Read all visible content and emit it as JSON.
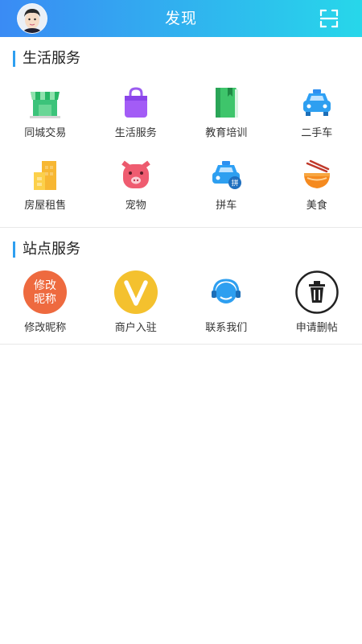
{
  "header": {
    "title": "发现"
  },
  "life": {
    "title": "生活服务",
    "items": [
      {
        "label": "同城交易",
        "icon": "market-stall-icon"
      },
      {
        "label": "生活服务",
        "icon": "shopping-bag-icon"
      },
      {
        "label": "教育培训",
        "icon": "book-icon"
      },
      {
        "label": "二手车",
        "icon": "car-icon"
      },
      {
        "label": "房屋租售",
        "icon": "building-icon"
      },
      {
        "label": "宠物",
        "icon": "pig-icon"
      },
      {
        "label": "拼车",
        "icon": "carpool-icon"
      },
      {
        "label": "美食",
        "icon": "noodle-bowl-icon"
      }
    ]
  },
  "site": {
    "title": "站点服务",
    "items": [
      {
        "label": "修改昵称",
        "icon": "edit-nickname-icon",
        "badge": "修改昵称"
      },
      {
        "label": "商户入驻",
        "icon": "merchant-v-icon"
      },
      {
        "label": "联系我们",
        "icon": "customer-service-icon"
      },
      {
        "label": "申请删帖",
        "icon": "trash-icon"
      }
    ]
  },
  "colors": {
    "accent": "#2e9ff0",
    "header_start": "#3a8bf4",
    "header_end": "#27d7ea"
  }
}
